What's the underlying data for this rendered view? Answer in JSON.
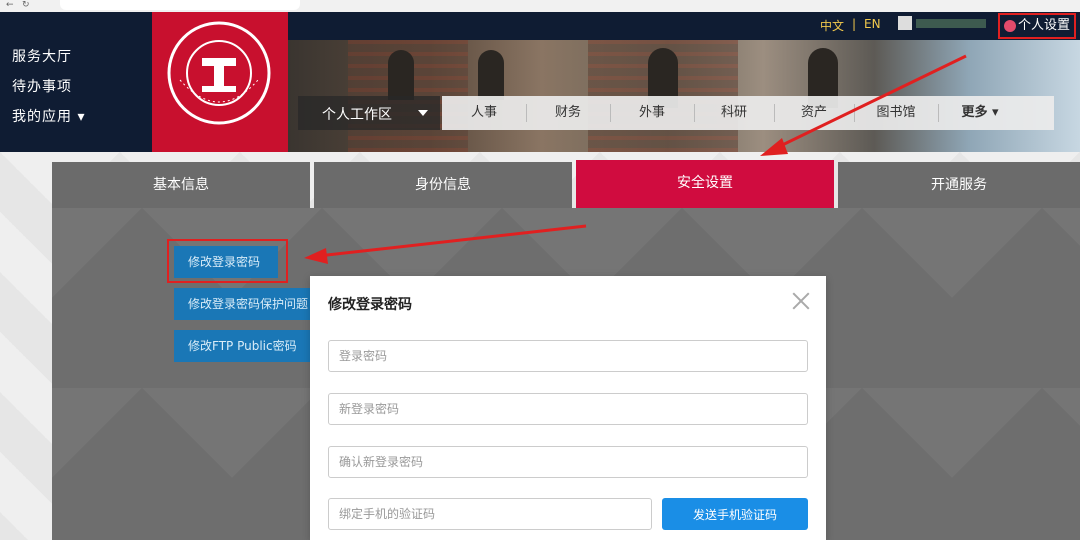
{
  "left_menu": {
    "items": [
      "服务大厅",
      "待办事项",
      "我的应用 ▾"
    ]
  },
  "topbar": {
    "lang_zh": "中文",
    "lang_sep": "|",
    "lang_en": "EN",
    "personal_settings": "个人设置"
  },
  "workarea": {
    "label": "个人工作区"
  },
  "nav": {
    "items": [
      "人事",
      "财务",
      "外事",
      "科研",
      "资产",
      "图书馆",
      "更多 ▾"
    ]
  },
  "tabs": [
    "基本信息",
    "身份信息",
    "安全设置",
    "开通服务"
  ],
  "active_tab": "安全设置",
  "sidebar_buttons": [
    "修改登录密码",
    "修改登录密码保护问题",
    "修改FTP Public密码"
  ],
  "modal": {
    "title": "修改登录密码",
    "fields": {
      "login_password": "登录密码",
      "new_password": "新登录密码",
      "confirm_password": "确认新登录密码",
      "sms_code": "绑定手机的验证码"
    },
    "send_code_button": "发送手机验证码"
  },
  "colors": {
    "brand_red": "#c8102e",
    "tab_active": "#d00c3f",
    "navy": "#0f1c33",
    "button_blue": "#1a77b6",
    "send_blue": "#1a8ee6",
    "annotation_red": "#e02020"
  }
}
